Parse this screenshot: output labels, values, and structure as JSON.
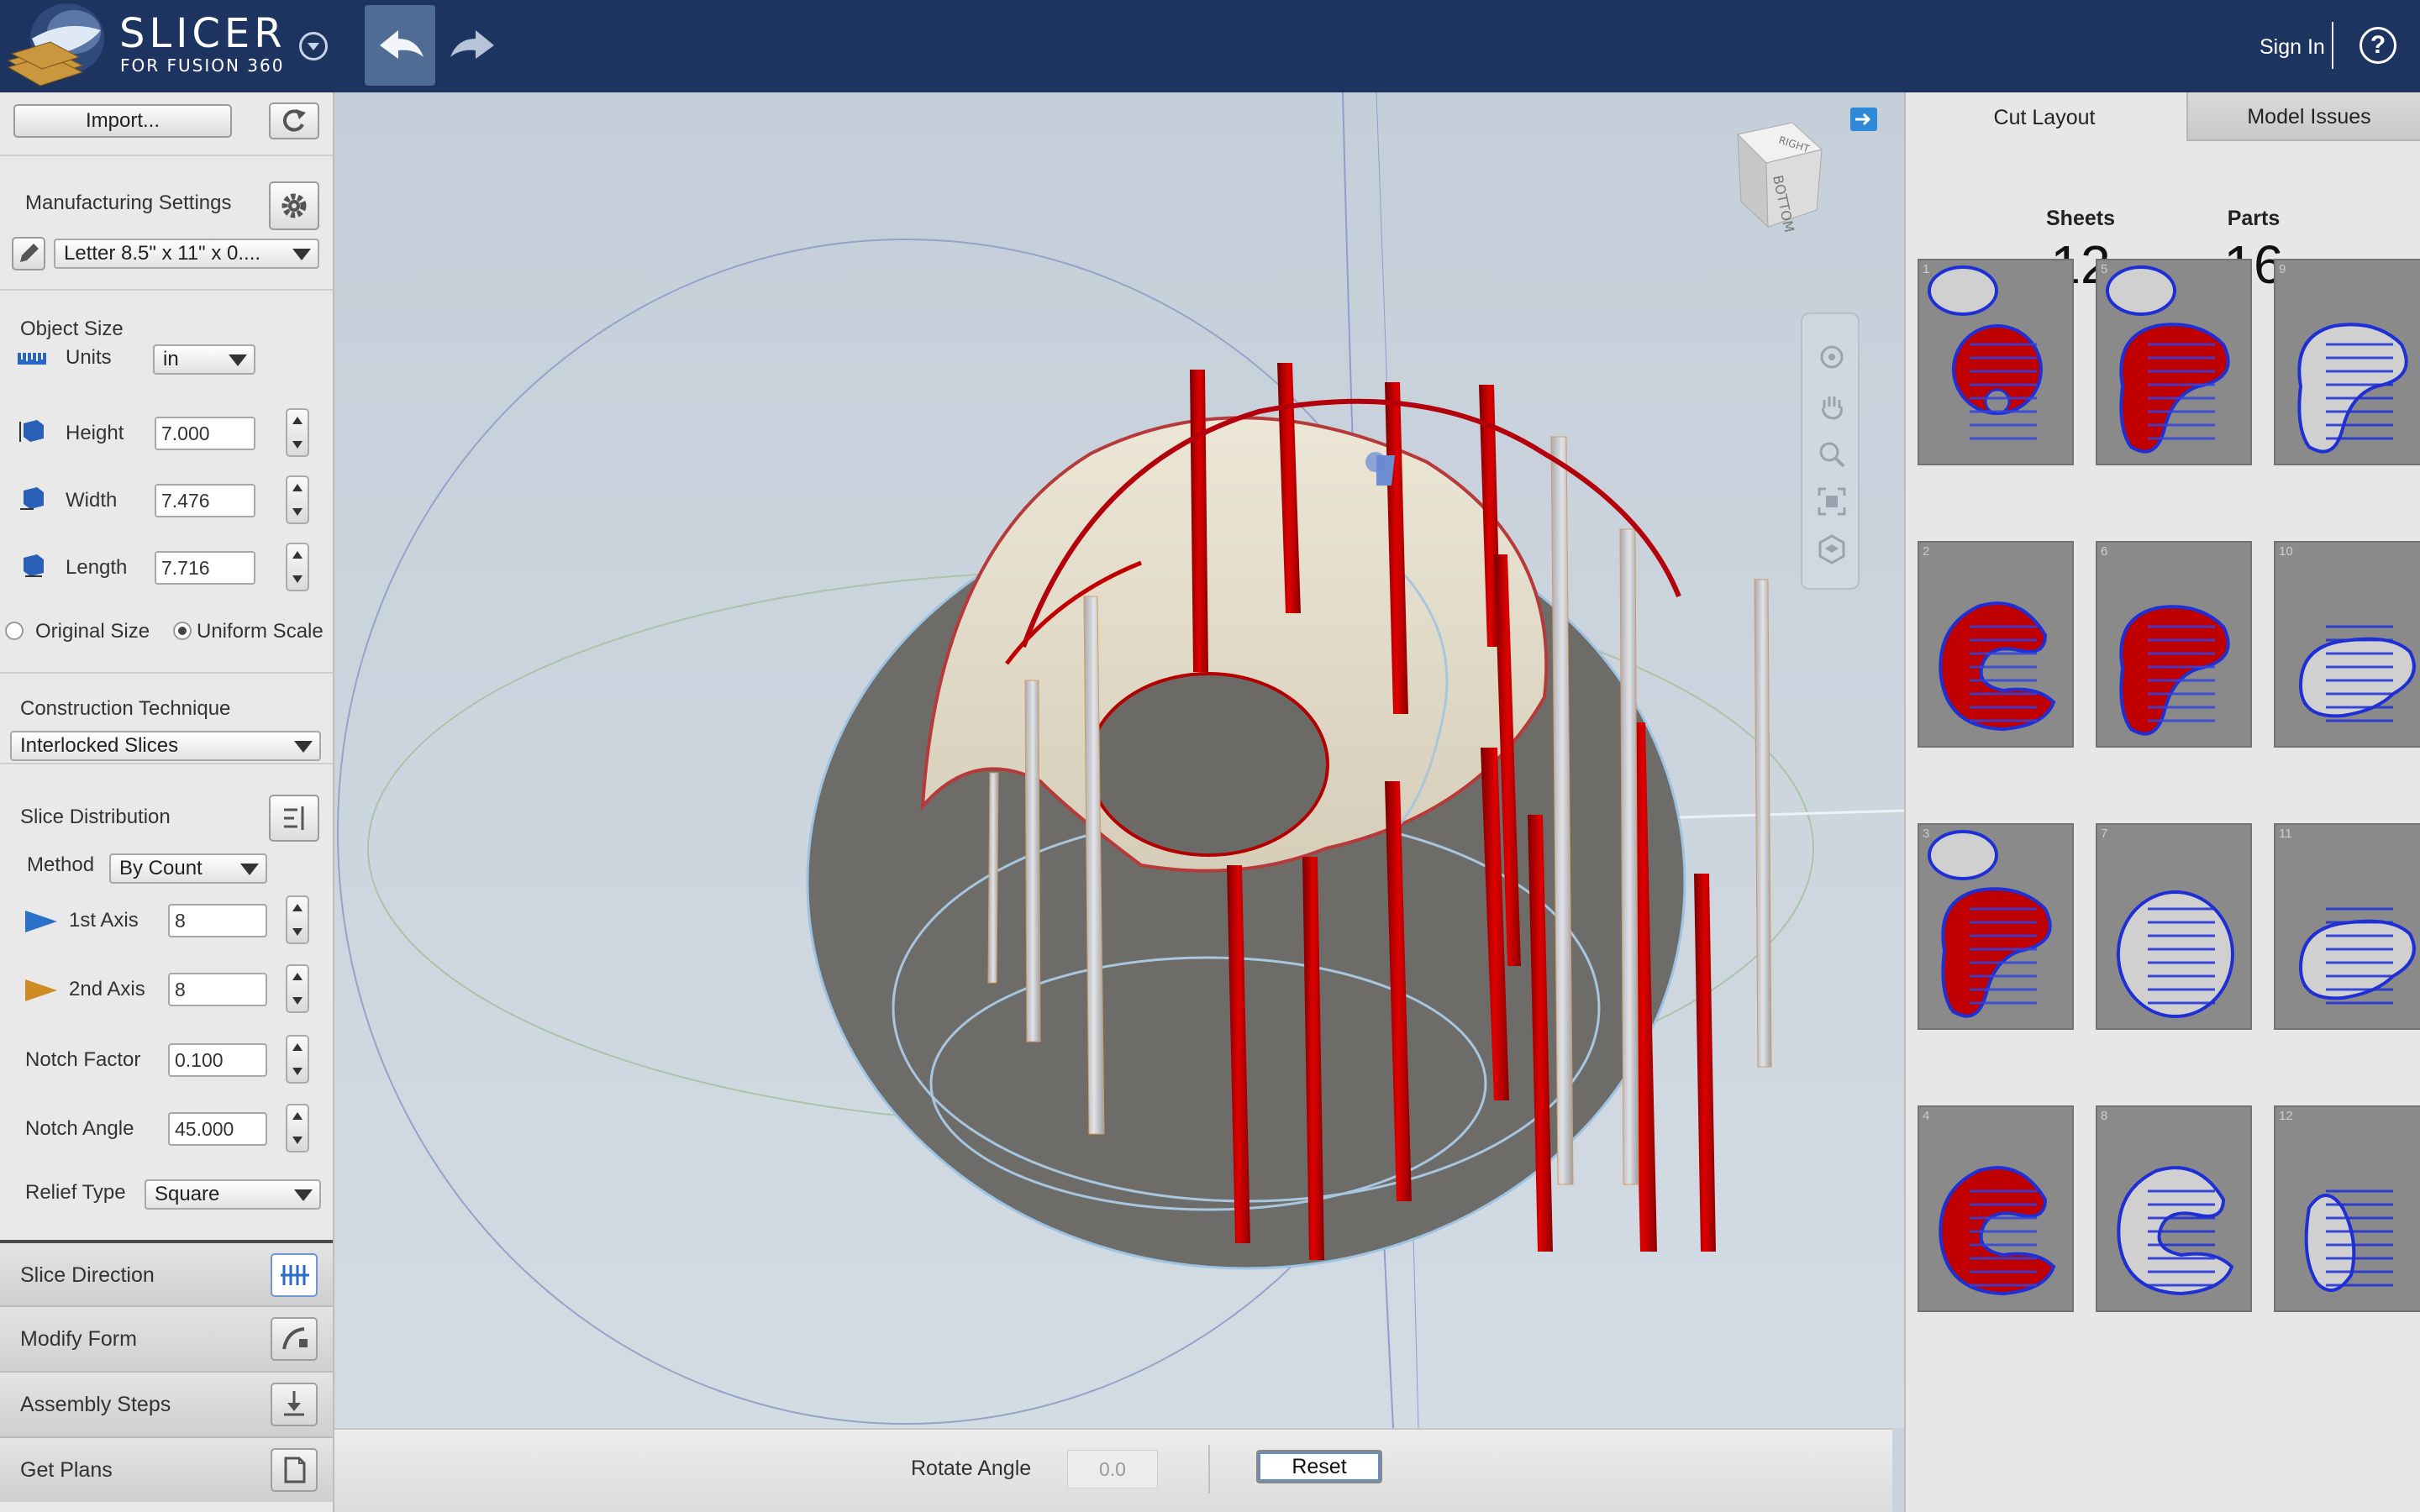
{
  "app": {
    "brand_name": "SLICER",
    "brand_sub": "FOR FUSION 360",
    "sign_in": "Sign In",
    "help": "?"
  },
  "left": {
    "import_label": "Import...",
    "manufacturing_title": "Manufacturing Settings",
    "material_value": "Letter 8.5\" x 11\" x 0....",
    "object_size_title": "Object Size",
    "units_label": "Units",
    "units_value": "in",
    "height_label": "Height",
    "height_value": "7.000",
    "width_label": "Width",
    "width_value": "7.476",
    "length_label": "Length",
    "length_value": "7.716",
    "original_size_label": "Original Size",
    "uniform_scale_label": "Uniform Scale",
    "construction_title": "Construction Technique",
    "construction_value": "Interlocked Slices",
    "slice_dist_title": "Slice Distribution",
    "method_label": "Method",
    "method_value": "By Count",
    "axis1_label": "1st Axis",
    "axis1_value": "8",
    "axis2_label": "2nd Axis",
    "axis2_value": "8",
    "notch_factor_label": "Notch Factor",
    "notch_factor_value": "0.100",
    "notch_angle_label": "Notch Angle",
    "notch_angle_value": "45.000",
    "relief_label": "Relief Type",
    "relief_value": "Square",
    "steps": [
      "Slice Direction",
      "Modify Form",
      "Assembly Steps",
      "Get Plans"
    ]
  },
  "viewport": {
    "viewcube_top": "RIGHT",
    "viewcube_front": "BOTTOM",
    "rotate_label": "Rotate Angle",
    "rotate_value": "0.0",
    "reset_label": "Reset"
  },
  "right": {
    "tab_cut": "Cut Layout",
    "tab_issues": "Model Issues",
    "sheets_label": "Sheets",
    "sheets_value": "12",
    "parts_label": "Parts",
    "parts_value": "16",
    "sheet_numbers": [
      "1",
      "5",
      "9",
      "2",
      "6",
      "10",
      "3",
      "7",
      "11",
      "4",
      "8",
      "12"
    ]
  },
  "colors": {
    "topbar": "#1d3461",
    "slice_red": "#c00000",
    "outline_blue": "#1f2fd6"
  }
}
